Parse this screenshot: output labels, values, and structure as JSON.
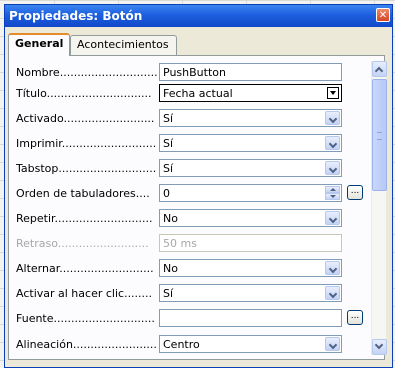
{
  "window": {
    "title": "Propiedades: Botón"
  },
  "tabs": [
    {
      "label": "General",
      "active": true
    },
    {
      "label": "Acontecimientos",
      "active": false
    }
  ],
  "properties": [
    {
      "label": "Nombre............................",
      "value": "PushButton",
      "control": "text",
      "enabled": true
    },
    {
      "label": "Título..............................",
      "value": "Fecha actual",
      "control": "dropdown-classic",
      "enabled": true
    },
    {
      "label": "Activado..........................",
      "value": "Sí",
      "control": "dropdown",
      "enabled": true
    },
    {
      "label": "Imprimir...........................",
      "value": "Sí",
      "control": "dropdown",
      "enabled": true
    },
    {
      "label": "Tabstop............................",
      "value": "Sí",
      "control": "dropdown",
      "enabled": true
    },
    {
      "label": "Orden de tabuladores....",
      "value": "0",
      "control": "spin",
      "enabled": true,
      "has_ellipsis": true
    },
    {
      "label": "Repetir............................",
      "value": "No",
      "control": "dropdown",
      "enabled": true
    },
    {
      "label": "Retraso..........................",
      "value": "50 ms",
      "control": "text",
      "enabled": false
    },
    {
      "label": "Alternar...........................",
      "value": "No",
      "control": "dropdown",
      "enabled": true
    },
    {
      "label": "Activar al hacer clic........",
      "value": "Sí",
      "control": "dropdown",
      "enabled": true
    },
    {
      "label": "Fuente.............................",
      "value": "",
      "control": "text",
      "enabled": true,
      "has_ellipsis": true
    },
    {
      "label": "Alineación........................",
      "value": "Centro",
      "control": "dropdown",
      "enabled": true
    }
  ],
  "ellipsis_label": "...",
  "close_glyph": "✕",
  "colors": {
    "titlebar": "#1d5fe0",
    "tab_accent": "#e68b2c",
    "field_border": "#7f9db9"
  }
}
